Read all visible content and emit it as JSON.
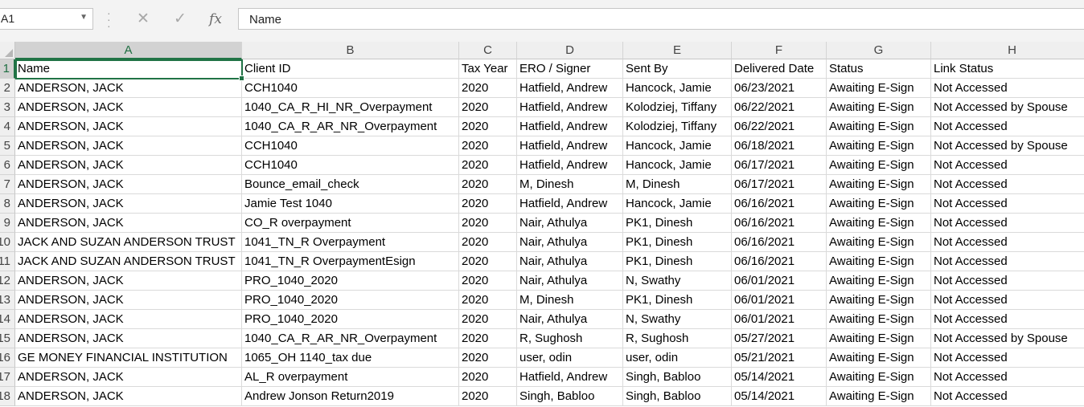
{
  "formula_bar": {
    "name_box": "A1",
    "name_box_dropdown_icon": "chevron-down-icon",
    "grip_icon": "vertical-grip-icon",
    "cancel_icon": "cross-icon",
    "enter_icon": "check-icon",
    "fx_label": "fx",
    "formula_value": "Name"
  },
  "columns": [
    "A",
    "B",
    "C",
    "D",
    "E",
    "F",
    "G",
    "H"
  ],
  "row_numbers": [
    "1",
    "2",
    "3",
    "4",
    "5",
    "6",
    "7",
    "8",
    "9",
    "10",
    "11",
    "12",
    "13",
    "14",
    "15",
    "16",
    "17",
    "18"
  ],
  "active_cell": "A1",
  "rows": [
    [
      "Name",
      "Client ID",
      "Tax Year",
      "ERO / Signer",
      "Sent By",
      "Delivered Date",
      "Status",
      "Link Status"
    ],
    [
      "ANDERSON, JACK",
      "CCH1040",
      "2020",
      "Hatfield, Andrew",
      "Hancock, Jamie",
      "06/23/2021",
      "Awaiting E-Sign",
      "Not Accessed"
    ],
    [
      "ANDERSON, JACK",
      "1040_CA_R_HI_NR_Overpayment",
      "2020",
      "Hatfield, Andrew",
      "Kolodziej, Tiffany",
      "06/22/2021",
      "Awaiting E-Sign",
      "Not Accessed by Spouse"
    ],
    [
      "ANDERSON, JACK",
      "1040_CA_R_AR_NR_Overpayment",
      "2020",
      "Hatfield, Andrew",
      "Kolodziej, Tiffany",
      "06/22/2021",
      "Awaiting E-Sign",
      "Not Accessed"
    ],
    [
      "ANDERSON, JACK",
      "CCH1040",
      "2020",
      "Hatfield, Andrew",
      "Hancock, Jamie",
      "06/18/2021",
      "Awaiting E-Sign",
      "Not Accessed by Spouse"
    ],
    [
      "ANDERSON, JACK",
      "CCH1040",
      "2020",
      "Hatfield, Andrew",
      "Hancock, Jamie",
      "06/17/2021",
      "Awaiting E-Sign",
      "Not Accessed"
    ],
    [
      "ANDERSON, JACK",
      "Bounce_email_check",
      "2020",
      "M, Dinesh",
      "M, Dinesh",
      "06/17/2021",
      "Awaiting E-Sign",
      "Not Accessed"
    ],
    [
      "ANDERSON, JACK",
      "Jamie Test 1040",
      "2020",
      "Hatfield, Andrew",
      "Hancock, Jamie",
      "06/16/2021",
      "Awaiting E-Sign",
      "Not Accessed"
    ],
    [
      "ANDERSON, JACK",
      "CO_R overpayment",
      "2020",
      "Nair, Athulya",
      "PK1, Dinesh",
      "06/16/2021",
      "Awaiting E-Sign",
      "Not Accessed"
    ],
    [
      "JACK AND SUZAN ANDERSON TRUST",
      "1041_TN_R Overpayment",
      "2020",
      "Nair, Athulya",
      "PK1, Dinesh",
      "06/16/2021",
      "Awaiting E-Sign",
      "Not Accessed"
    ],
    [
      "JACK AND SUZAN ANDERSON TRUST",
      "1041_TN_R OverpaymentEsign",
      "2020",
      "Nair, Athulya",
      "PK1, Dinesh",
      "06/16/2021",
      "Awaiting E-Sign",
      "Not Accessed"
    ],
    [
      "ANDERSON, JACK",
      "PRO_1040_2020",
      "2020",
      "Nair, Athulya",
      "N, Swathy",
      "06/01/2021",
      "Awaiting E-Sign",
      "Not Accessed"
    ],
    [
      "ANDERSON, JACK",
      "PRO_1040_2020",
      "2020",
      "M, Dinesh",
      "PK1, Dinesh",
      "06/01/2021",
      "Awaiting E-Sign",
      "Not Accessed"
    ],
    [
      "ANDERSON, JACK",
      "PRO_1040_2020",
      "2020",
      "Nair, Athulya",
      "N, Swathy",
      "06/01/2021",
      "Awaiting E-Sign",
      "Not Accessed"
    ],
    [
      "ANDERSON, JACK",
      "1040_CA_R_AR_NR_Overpayment",
      "2020",
      "R, Sughosh",
      "R, Sughosh",
      "05/27/2021",
      "Awaiting E-Sign",
      "Not Accessed by Spouse"
    ],
    [
      "GE MONEY FINANCIAL INSTITUTION",
      "1065_OH 1140_tax due",
      "2020",
      "user, odin",
      "user, odin",
      "05/21/2021",
      "Awaiting E-Sign",
      "Not Accessed"
    ],
    [
      "ANDERSON, JACK",
      "AL_R overpayment",
      "2020",
      "Hatfield, Andrew",
      "Singh, Babloo",
      "05/14/2021",
      "Awaiting E-Sign",
      "Not Accessed"
    ],
    [
      "ANDERSON, JACK",
      "Andrew Jonson Return2019",
      "2020",
      "Singh, Babloo",
      "Singh, Babloo",
      "05/14/2021",
      "Awaiting E-Sign",
      "Not Accessed"
    ]
  ]
}
